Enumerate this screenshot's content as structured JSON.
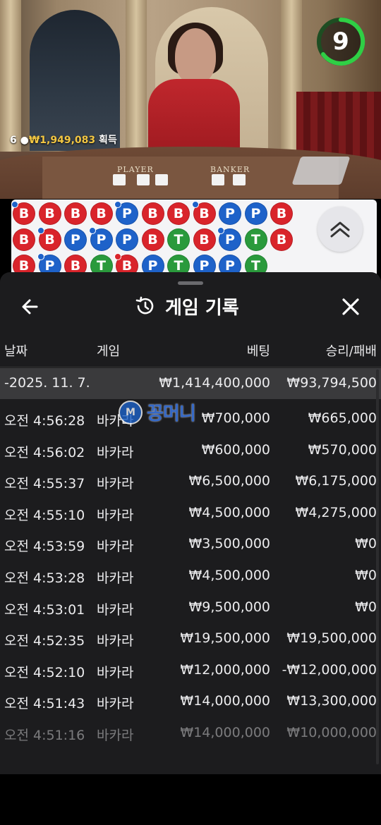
{
  "video": {
    "winners_count": "6",
    "winners_amount": "₩1,949,083",
    "winners_suffix": "획득",
    "table_labels": {
      "player": "PLAYER",
      "banker": "BANKER"
    },
    "timer": "9"
  },
  "bead_road": {
    "rows": [
      [
        "B",
        "B",
        "B",
        "B",
        "P",
        "B",
        "B",
        "B",
        "P",
        "P",
        "B"
      ],
      [
        "B",
        "B",
        "P",
        "P",
        "P",
        "B",
        "T",
        "B",
        "P",
        "T",
        "B"
      ],
      [
        "B",
        "P",
        "B",
        "T",
        "B",
        "P",
        "T",
        "P",
        "P",
        "T"
      ]
    ],
    "colors": {
      "B": "#d9242b",
      "P": "#1e62c9",
      "T": "#2a9a3c"
    }
  },
  "history": {
    "title": "게임 기록",
    "icons": {
      "back": "arrow-left-icon",
      "history": "history-icon",
      "close": "close-icon"
    },
    "columns": {
      "date": "날짜",
      "game": "게임",
      "bet": "베팅",
      "result": "승리/패배"
    },
    "date_row": {
      "date": "-2025. 11. 7.",
      "bet": "₩1,414,400,000",
      "result": "₩93,794,500"
    },
    "rows": [
      {
        "time": "오전 4:56:28",
        "game": "바카라",
        "bet": "₩700,000",
        "result": "₩665,000"
      },
      {
        "time": "오전 4:56:02",
        "game": "바카라",
        "bet": "₩600,000",
        "result": "₩570,000"
      },
      {
        "time": "오전 4:55:37",
        "game": "바카라",
        "bet": "₩6,500,000",
        "result": "₩6,175,000"
      },
      {
        "time": "오전 4:55:10",
        "game": "바카라",
        "bet": "₩4,500,000",
        "result": "₩4,275,000"
      },
      {
        "time": "오전 4:53:59",
        "game": "바카라",
        "bet": "₩3,500,000",
        "result": "₩0"
      },
      {
        "time": "오전 4:53:28",
        "game": "바카라",
        "bet": "₩4,500,000",
        "result": "₩0"
      },
      {
        "time": "오전 4:53:01",
        "game": "바카라",
        "bet": "₩9,500,000",
        "result": "₩0"
      },
      {
        "time": "오전 4:52:35",
        "game": "바카라",
        "bet": "₩19,500,000",
        "result": "₩19,500,000"
      },
      {
        "time": "오전 4:52:10",
        "game": "바카라",
        "bet": "₩12,000,000",
        "result": "-₩12,000,000"
      },
      {
        "time": "오전 4:51:43",
        "game": "바카라",
        "bet": "₩14,000,000",
        "result": "₩13,300,000"
      },
      {
        "time": "오전 4:51:16",
        "game": "바카라",
        "bet": "₩14,000,000",
        "result": "₩10,000,000"
      }
    ]
  },
  "watermark": {
    "text": "꽁머니"
  }
}
